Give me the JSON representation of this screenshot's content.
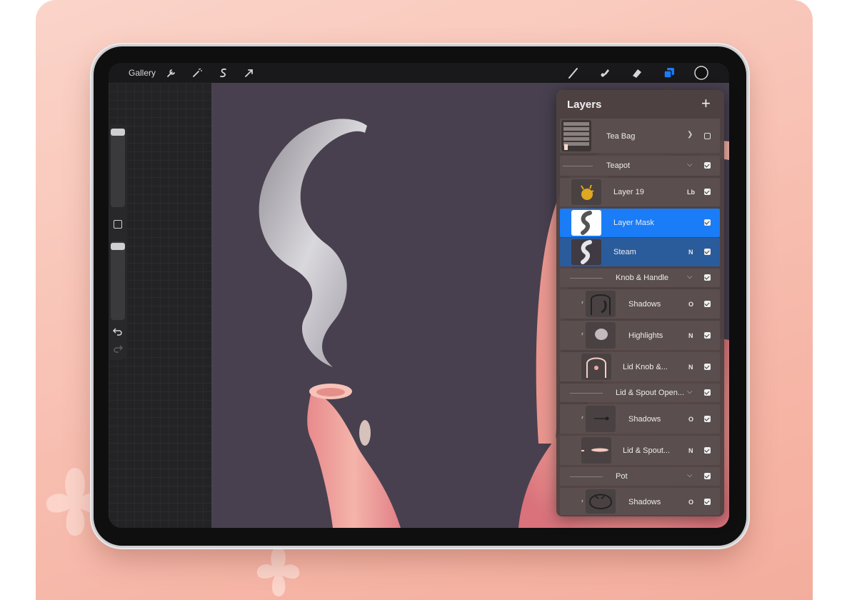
{
  "topbar": {
    "gallery_label": "Gallery",
    "left_icons": [
      "wrench-icon",
      "magic-wand-icon",
      "selection-icon",
      "transform-arrow-icon"
    ],
    "right_icons": [
      "brush-icon",
      "smudge-icon",
      "eraser-icon",
      "layers-icon",
      "color-swatch-icon"
    ],
    "accent_color": "#1a7cf6"
  },
  "layers_panel": {
    "title": "Layers",
    "add_label": "+",
    "rows": [
      {
        "name": "Tea Bag",
        "mode": "",
        "kind": "group-collapsed",
        "visible": false
      },
      {
        "name": "Teapot",
        "mode": "",
        "kind": "group-header",
        "visible": true
      },
      {
        "name": "Layer 19",
        "mode": "Lb",
        "kind": "layer",
        "visible": true
      },
      {
        "name": "Layer Mask",
        "mode": "",
        "kind": "mask-selected",
        "visible": true
      },
      {
        "name": "Steam",
        "mode": "N",
        "kind": "layer-selected",
        "visible": true
      },
      {
        "name": "Knob & Handle",
        "mode": "",
        "kind": "group-header",
        "visible": true
      },
      {
        "name": "Shadows",
        "mode": "O",
        "kind": "clipped-layer",
        "visible": true
      },
      {
        "name": "Highlights",
        "mode": "N",
        "kind": "clipped-layer",
        "visible": true
      },
      {
        "name": "Lid Knob &...",
        "mode": "N",
        "kind": "layer",
        "visible": true
      },
      {
        "name": "Lid & Spout Open...",
        "mode": "",
        "kind": "group-header",
        "visible": true
      },
      {
        "name": "Shadows",
        "mode": "O",
        "kind": "clipped-layer",
        "visible": true
      },
      {
        "name": "Lid & Spout...",
        "mode": "N",
        "kind": "layer",
        "visible": true
      },
      {
        "name": "Pot",
        "mode": "",
        "kind": "group-header",
        "visible": true
      },
      {
        "name": "Shadows",
        "mode": "O",
        "kind": "clipped-layer",
        "visible": true
      }
    ]
  }
}
